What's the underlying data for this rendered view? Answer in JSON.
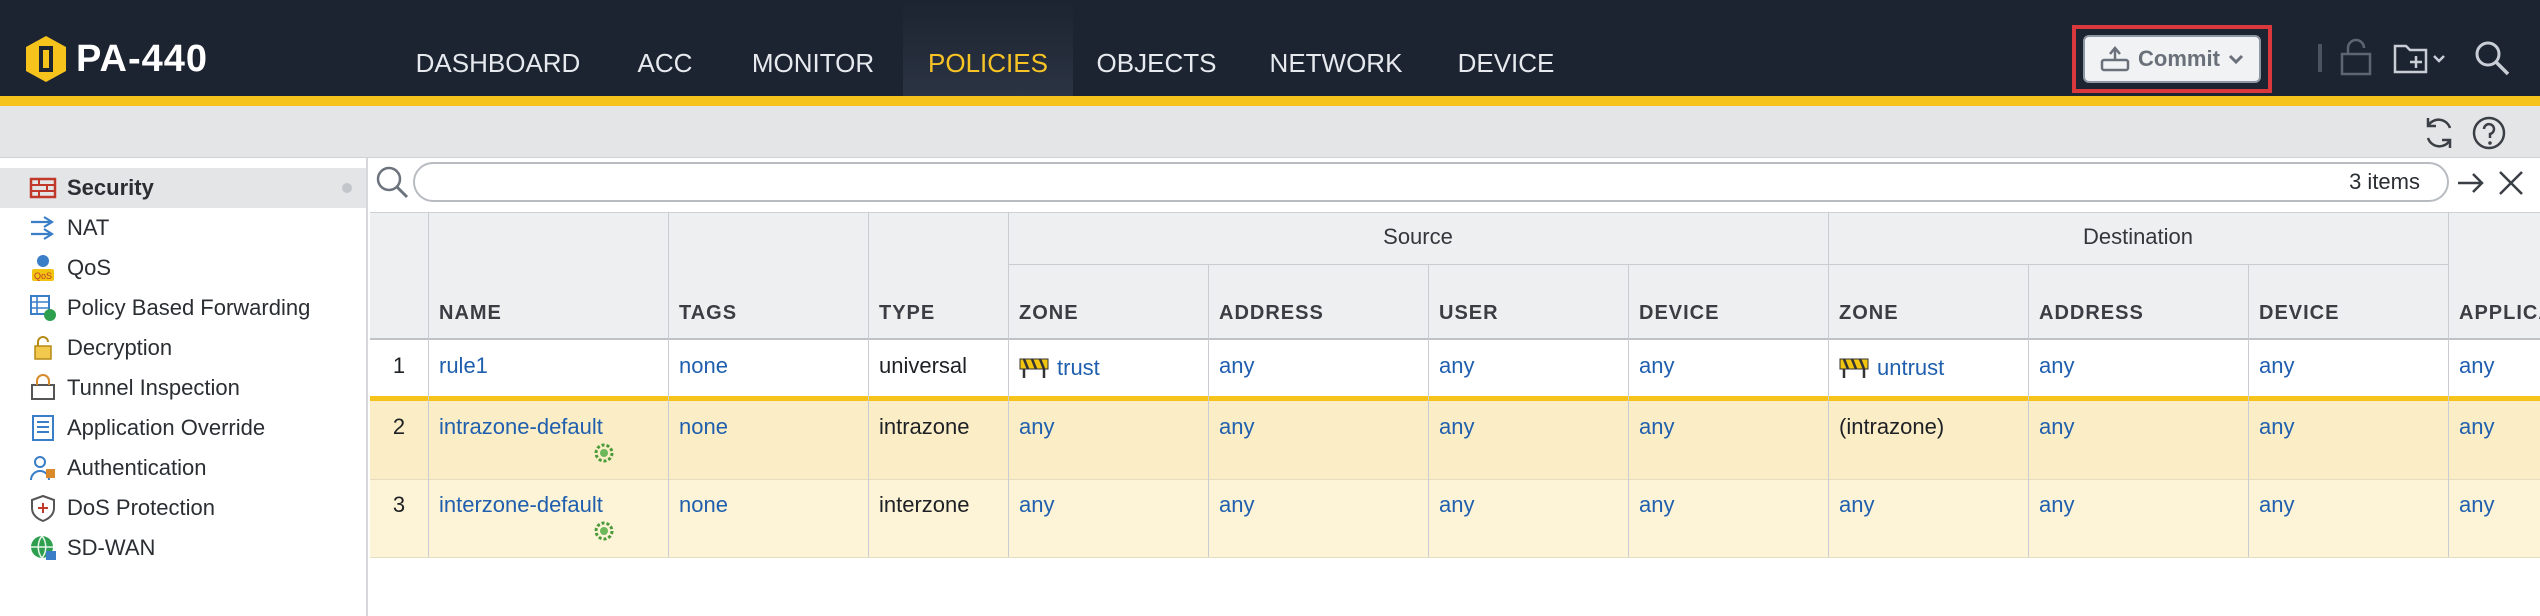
{
  "app": {
    "name": "PA-440",
    "nav_tabs": [
      {
        "label": "DASHBOARD",
        "active": false
      },
      {
        "label": "ACC",
        "active": false
      },
      {
        "label": "MONITOR",
        "active": false
      },
      {
        "label": "POLICIES",
        "active": true
      },
      {
        "label": "OBJECTS",
        "active": false
      },
      {
        "label": "NETWORK",
        "active": false
      },
      {
        "label": "DEVICE",
        "active": false
      }
    ],
    "commit_label": "Commit"
  },
  "sidebar": {
    "items": [
      {
        "label": "Security",
        "icon": "security-rules-icon",
        "active": true
      },
      {
        "label": "NAT",
        "icon": "nat-icon",
        "active": false
      },
      {
        "label": "QoS",
        "icon": "qos-icon",
        "active": false
      },
      {
        "label": "Policy Based Forwarding",
        "icon": "pbf-icon",
        "active": false
      },
      {
        "label": "Decryption",
        "icon": "lock-icon",
        "active": false
      },
      {
        "label": "Tunnel Inspection",
        "icon": "tunnel-icon",
        "active": false
      },
      {
        "label": "Application Override",
        "icon": "app-override-icon",
        "active": false
      },
      {
        "label": "Authentication",
        "icon": "authentication-icon",
        "active": false
      },
      {
        "label": "DoS Protection",
        "icon": "dos-shield-icon",
        "active": false
      },
      {
        "label": "SD-WAN",
        "icon": "sdwan-globe-icon",
        "active": false
      }
    ]
  },
  "search": {
    "value": "",
    "placeholder": "",
    "count": "3 items"
  },
  "table": {
    "groups": {
      "source": "Source",
      "destination": "Destination"
    },
    "columns": {
      "name": "NAME",
      "tags": "TAGS",
      "type": "TYPE",
      "src_zone": "ZONE",
      "src_address": "ADDRESS",
      "src_user": "USER",
      "src_device": "DEVICE",
      "dst_zone": "ZONE",
      "dst_address": "ADDRESS",
      "dst_device": "DEVICE",
      "application": "APPLICA"
    },
    "rows": [
      {
        "num": "1",
        "name": "rule1",
        "tags": "none",
        "type": "universal",
        "src_zone": "trust",
        "src_address": "any",
        "src_user": "any",
        "src_device": "any",
        "dst_zone": "untrust",
        "dst_address": "any",
        "dst_device": "any",
        "application": "any"
      },
      {
        "num": "2",
        "name": "intrazone-default",
        "tags": "none",
        "type": "intrazone",
        "src_zone": "any",
        "src_address": "any",
        "src_user": "any",
        "src_device": "any",
        "dst_zone": "(intrazone)",
        "dst_address": "any",
        "dst_device": "any",
        "application": "any"
      },
      {
        "num": "3",
        "name": "interzone-default",
        "tags": "none",
        "type": "interzone",
        "src_zone": "any",
        "src_address": "any",
        "src_user": "any",
        "src_device": "any",
        "dst_zone": "any",
        "dst_address": "any",
        "dst_device": "any",
        "application": "any"
      }
    ]
  },
  "colors": {
    "nav_bg": "#1c2331",
    "accent_yellow": "#f6c31d",
    "link_blue": "#1f5fae",
    "highlight_border": "#d9393c",
    "default_row_bg": "#fdf3d6",
    "default_row_bg_alt": "#fbeec6"
  }
}
